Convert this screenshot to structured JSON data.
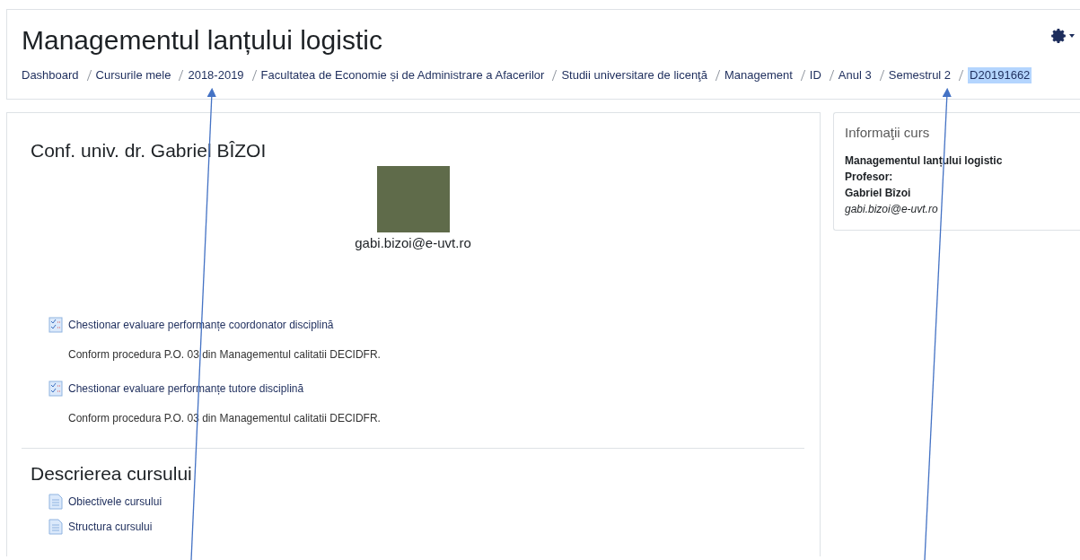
{
  "header": {
    "title": "Managementul lanțului logistic",
    "breadcrumbs": [
      {
        "label": "Dashboard",
        "highlighted": false
      },
      {
        "label": "Cursurile mele",
        "highlighted": false
      },
      {
        "label": "2018-2019",
        "highlighted": false
      },
      {
        "label": "Facultatea de Economie și de Administrare a Afacerilor",
        "highlighted": false
      },
      {
        "label": "Studii universitare de licenţă",
        "highlighted": false
      },
      {
        "label": "Management",
        "highlighted": false
      },
      {
        "label": "ID",
        "highlighted": false
      },
      {
        "label": "Anul 3",
        "highlighted": false
      },
      {
        "label": "Semestrul 2",
        "highlighted": false
      },
      {
        "label": "D20191662",
        "highlighted": true
      }
    ]
  },
  "main": {
    "teacher_heading": "Conf. univ. dr. Gabriel BÎZOI",
    "email": "gabi.bizoi@e-uvt.ro",
    "activities": [
      {
        "kind": "feedback",
        "label": "Chestionar evaluare performanțe coordonator disciplină",
        "description": "Conform procedura P.O. 03 din Managementul calitatii DECIDFR."
      },
      {
        "kind": "feedback",
        "label": "Chestionar evaluare performanțe tutore disciplină",
        "description": "Conform procedura P.O. 03 din Managementul calitatii DECIDFR."
      }
    ],
    "section_heading": "Descrierea cursului",
    "resources": [
      {
        "kind": "page",
        "label": "Obiectivele cursului"
      },
      {
        "kind": "page",
        "label": "Structura cursului"
      }
    ]
  },
  "sidebar": {
    "title": "Informaţii curs",
    "course": "Managementul lanțului logistic",
    "role": "Profesor:",
    "teacher": "Gabriel Bîzoi",
    "email": "gabi.bizoi@e-uvt.ro"
  }
}
